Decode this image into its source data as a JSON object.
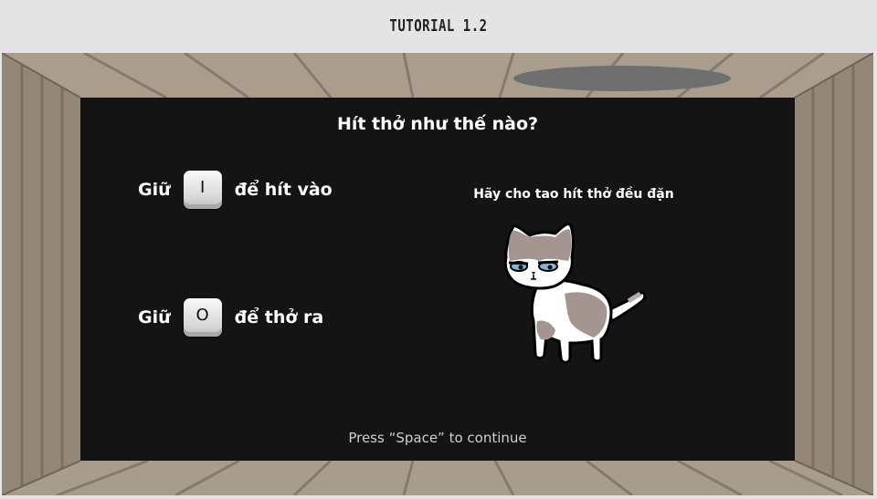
{
  "header": {
    "title": "TUTORIAL 1.2"
  },
  "panel": {
    "heading": "Hít thở như thế nào?",
    "inhale": {
      "prefix": "Giữ",
      "key": "I",
      "suffix": "để hít vào"
    },
    "exhale": {
      "prefix": "Giữ",
      "key": "O",
      "suffix": "để thở ra"
    },
    "cat_caption": "Hãy cho tao hít thở đều đặn",
    "continue_hint": "Press “Space” to continue"
  },
  "colors": {
    "panel": "#141414",
    "wood": "#9e9283",
    "wood_dark": "#7d7264",
    "hole": "#6f6f6f"
  },
  "icons": {
    "cat": "cat-illustration-icon",
    "hole": "floor-hole-icon"
  }
}
